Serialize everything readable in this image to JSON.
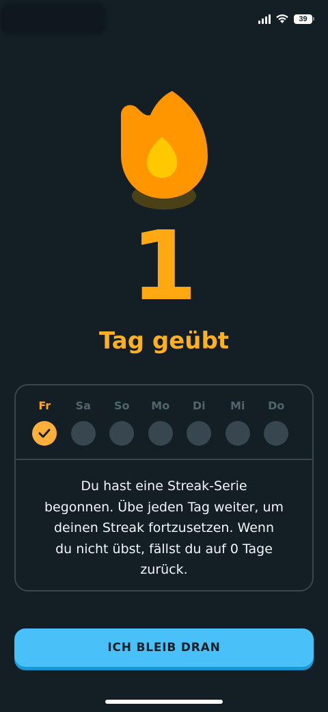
{
  "status_bar": {
    "battery": "39"
  },
  "streak": {
    "count": "1",
    "label": "Tag geübt"
  },
  "week": {
    "days": [
      {
        "label": "Fr",
        "done": true
      },
      {
        "label": "Sa",
        "done": false
      },
      {
        "label": "So",
        "done": false
      },
      {
        "label": "Mo",
        "done": false
      },
      {
        "label": "Di",
        "done": false
      },
      {
        "label": "Mi",
        "done": false
      },
      {
        "label": "Do",
        "done": false
      }
    ]
  },
  "info": {
    "lines": [
      "Du hast eine Streak-Serie",
      "begonnen. Übe jeden Tag weiter, um",
      "deinen Streak fortzusetzen. Wenn",
      "du nicht übst, fällst du auf 0 Tage",
      "zurück."
    ]
  },
  "cta": {
    "label": "ICH BLEIB DRAN"
  },
  "colors": {
    "background": "#131f24",
    "accent": "#ffa811",
    "button": "#49c0f8",
    "border": "#37464f"
  },
  "icons": [
    "cellular-signal-icon",
    "wifi-icon",
    "battery-icon",
    "flame-icon",
    "checkmark-icon"
  ]
}
